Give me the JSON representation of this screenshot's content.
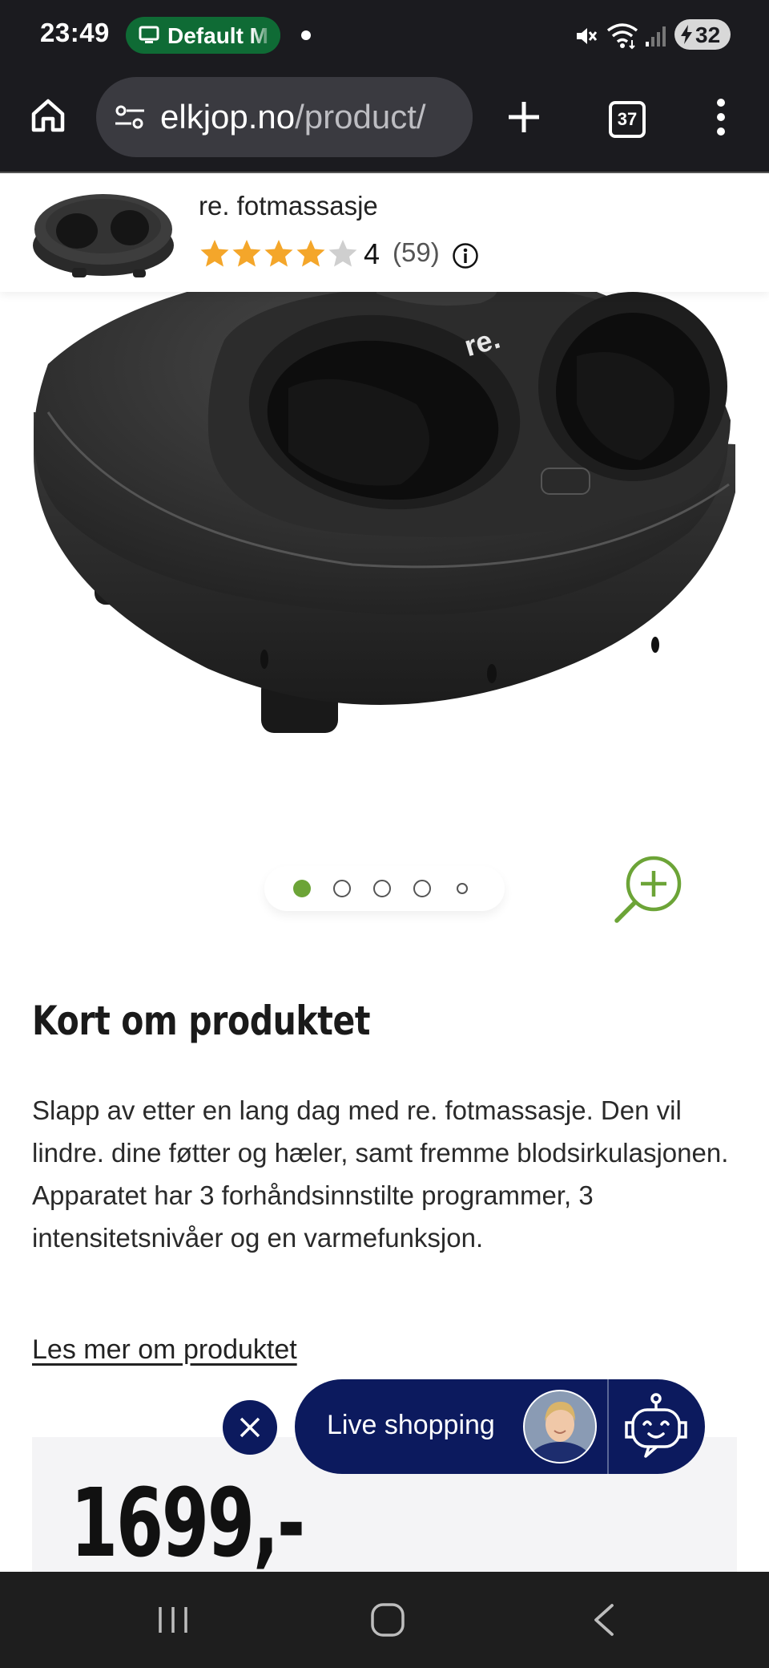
{
  "status_bar": {
    "time": "23:49",
    "cast_label": "Default M",
    "battery": "32",
    "icons": [
      "mute-icon",
      "wifi-icon",
      "signal-icon",
      "battery-charging-icon"
    ]
  },
  "browser": {
    "url_host": "elkjop.no",
    "url_path": "/product/",
    "tab_count": "37"
  },
  "sticky_header": {
    "product_name": "re. fotmassasje",
    "rating_value": "4",
    "rating_count": "(59)",
    "stars_filled": 4,
    "stars_total": 5
  },
  "carousel": {
    "dot_count": 5,
    "active_index": 0,
    "accent": "#6ca437"
  },
  "product": {
    "brand_mark": "re.",
    "heading": "Kort om produktet",
    "description": "Slapp av etter en lang dag med re. fotmassasje. Den vil lindre. dine føtter og hæler, samt fremme blodsirkulasjonen. Apparatet har 3 forhåndsinnstilte programmer, 3 intensitetsnivåer og en varmefunksjon.",
    "read_more": "Les mer om produktet",
    "price": "1699,-"
  },
  "live_shopping": {
    "label": "Live shopping",
    "color": "#0c1a5e"
  },
  "colors": {
    "star": "#f4a62a",
    "star_empty": "#cfcfcf",
    "cast_green": "#0f6b35"
  }
}
